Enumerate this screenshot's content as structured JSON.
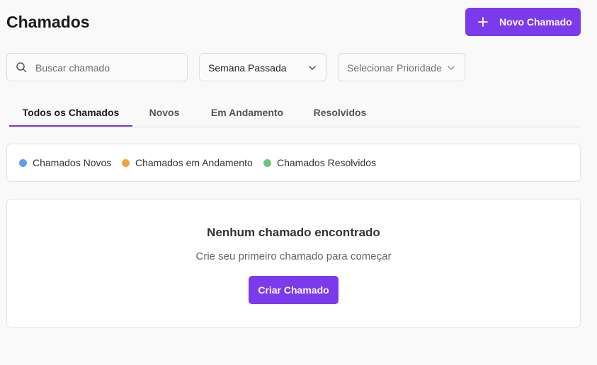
{
  "header": {
    "title": "Chamados",
    "new_button_label": "Novo Chamado",
    "new_button_icon": "plus-icon"
  },
  "filters": {
    "search_placeholder": "Buscar chamado",
    "search_value": "",
    "search_icon": "search-icon",
    "period_value": "Semana Passada",
    "priority_placeholder": "Selecionar Prioridade",
    "chevron_icon": "chevron-down-icon"
  },
  "tabs": [
    {
      "label": "Todos os Chamados",
      "active": true
    },
    {
      "label": "Novos",
      "active": false
    },
    {
      "label": "Em Andamento",
      "active": false
    },
    {
      "label": "Resolvidos",
      "active": false
    }
  ],
  "legend": [
    {
      "label": "Chamados Novos",
      "color": "#5b9cf2"
    },
    {
      "label": "Chamados em Andamento",
      "color": "#f5a03a"
    },
    {
      "label": "Chamados Resolvidos",
      "color": "#72c47a"
    }
  ],
  "empty_state": {
    "title": "Nenhum chamado encontrado",
    "subtitle": "Crie seu primeiro chamado para começar",
    "button_label": "Criar Chamado"
  },
  "colors": {
    "accent": "#7c3aed"
  }
}
